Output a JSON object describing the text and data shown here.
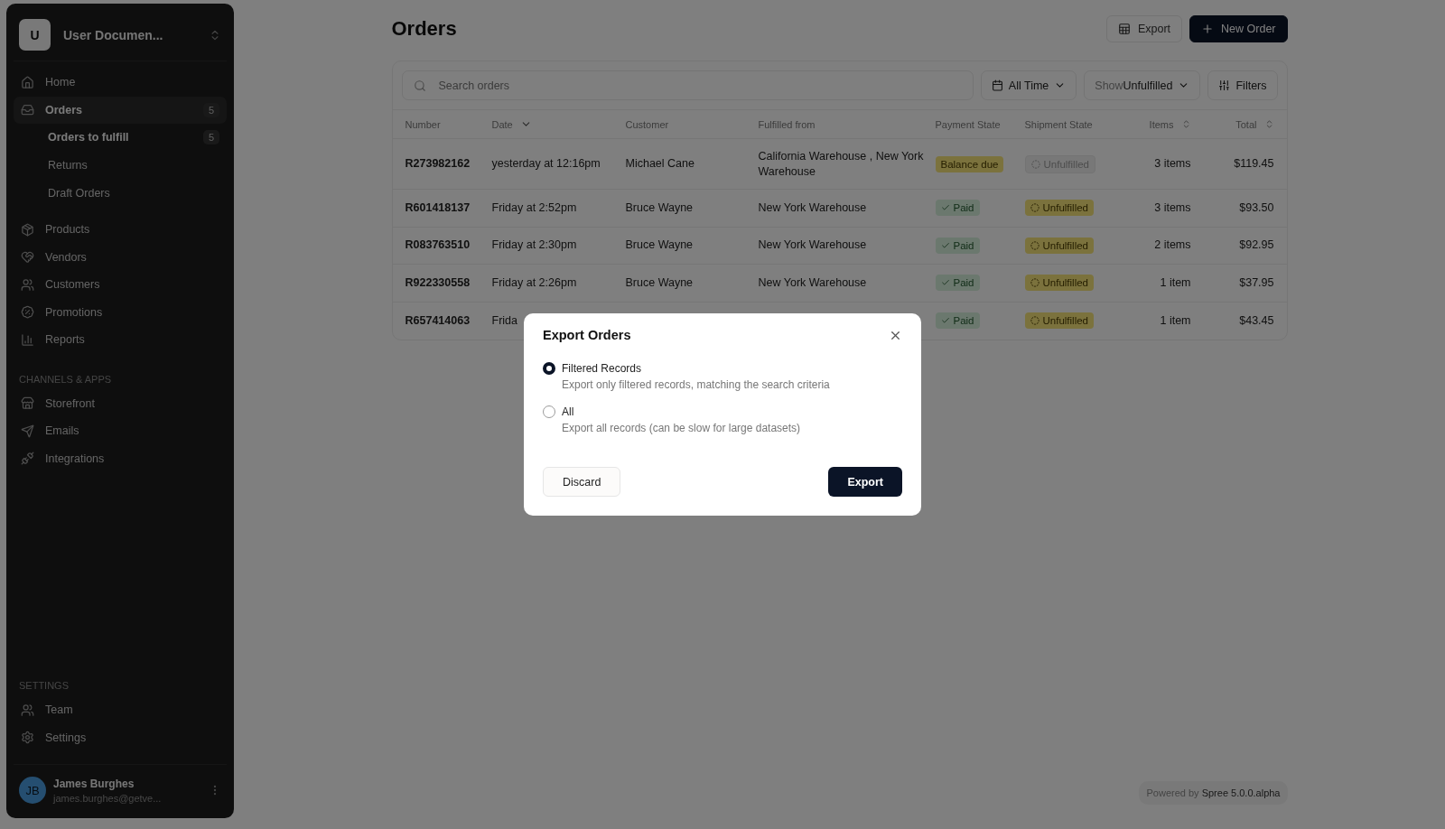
{
  "workspace": {
    "initial": "U",
    "name": "User Documen..."
  },
  "nav": [
    {
      "label": "Home",
      "selected": false
    },
    {
      "label": "Orders",
      "selected": true,
      "count": "5",
      "children": [
        {
          "label": "Orders to fulfill",
          "selected": true,
          "count": "5"
        },
        {
          "label": "Returns",
          "selected": false
        },
        {
          "label": "Draft Orders",
          "selected": false
        }
      ]
    },
    {
      "label": "Products",
      "selected": false
    },
    {
      "label": "Vendors",
      "selected": false
    },
    {
      "label": "Customers",
      "selected": false
    },
    {
      "label": "Promotions",
      "selected": false
    },
    {
      "label": "Reports",
      "selected": false
    }
  ],
  "channels": {
    "heading": "CHANNELS & APPS",
    "items": [
      {
        "label": "Storefront",
        "selected": false
      },
      {
        "label": "Emails",
        "selected": false
      },
      {
        "label": "Integrations",
        "selected": false
      }
    ]
  },
  "settings": {
    "heading": "SETTINGS",
    "items": [
      {
        "label": "Team",
        "selected": false
      },
      {
        "label": "Settings",
        "selected": false
      }
    ]
  },
  "user": {
    "initials": "JB",
    "name": "James Burghes",
    "email": "james.burghes@getve..."
  },
  "page": {
    "title": "Orders",
    "actions": [
      {
        "kind": "secondary",
        "label": "Export"
      },
      {
        "kind": "primary",
        "label": "New Order"
      }
    ]
  },
  "toolbar": {
    "search": {
      "placeholder": "Search orders"
    },
    "filters": [
      {
        "kind": "date",
        "value": "All Time"
      },
      {
        "kind": "select",
        "label": "Show",
        "value": "Unfulfilled"
      },
      {
        "kind": "filters",
        "value": "Filters"
      }
    ]
  },
  "table": {
    "columns": [
      {
        "label": "Number",
        "sorted": false,
        "sortable": false
      },
      {
        "label": "Date",
        "sorted": true,
        "sortable": true
      },
      {
        "label": "Customer",
        "sorted": false,
        "sortable": false
      },
      {
        "label": "Fulfilled from",
        "sorted": false,
        "sortable": false
      },
      {
        "label": "Payment State",
        "sorted": false,
        "sortable": false
      },
      {
        "label": "Shipment State",
        "sorted": false,
        "sortable": false
      },
      {
        "label": "Items",
        "sorted": false,
        "sortable": true
      },
      {
        "label": "Total",
        "sorted": false,
        "sortable": true
      }
    ],
    "rows": [
      {
        "number": "R273982162",
        "date": "yesterday at 12:16pm",
        "customer": "Michael Cane",
        "fulfilled_from": "California Warehouse , New York Warehouse",
        "payment": {
          "label": "Balance due",
          "kind": "warning"
        },
        "shipment": {
          "label": "Unfulfilled",
          "kind": "neutral"
        },
        "items": "3 items",
        "total": "$119.45"
      },
      {
        "number": "R601418137",
        "date": "Friday at 2:52pm",
        "customer": "Bruce Wayne",
        "fulfilled_from": "New York Warehouse",
        "payment": {
          "label": "Paid",
          "kind": "success"
        },
        "shipment": {
          "label": "Unfulfilled",
          "kind": "warning"
        },
        "items": "3 items",
        "total": "$93.50"
      },
      {
        "number": "R083763510",
        "date": "Friday at 2:30pm",
        "customer": "Bruce Wayne",
        "fulfilled_from": "New York Warehouse",
        "payment": {
          "label": "Paid",
          "kind": "success"
        },
        "shipment": {
          "label": "Unfulfilled",
          "kind": "warning"
        },
        "items": "2 items",
        "total": "$92.95"
      },
      {
        "number": "R922330558",
        "date": "Friday at 2:26pm",
        "customer": "Bruce Wayne",
        "fulfilled_from": "New York Warehouse",
        "payment": {
          "label": "Paid",
          "kind": "success"
        },
        "shipment": {
          "label": "Unfulfilled",
          "kind": "warning"
        },
        "items": "1 item",
        "total": "$37.95"
      },
      {
        "number": "R657414063",
        "date": "Frida",
        "payment": {
          "label": "Paid",
          "kind": "success"
        },
        "shipment": {
          "label": "Unfulfilled",
          "kind": "warning"
        },
        "items": "1 item",
        "total": "$43.45"
      }
    ]
  },
  "powered_by": {
    "label": "Powered by",
    "product": "Spree 5.0.0.alpha"
  },
  "dialog": {
    "title": "Export Orders",
    "options": [
      {
        "label": "Filtered Records",
        "description": "Export only filtered records, matching the search criteria",
        "selected": true
      },
      {
        "label": "All",
        "description": "Export all records (can be slow for large datasets)",
        "selected": false
      }
    ],
    "buttons": [
      {
        "kind": "secondary",
        "label": "Discard"
      },
      {
        "kind": "primary",
        "label": "Export"
      }
    ]
  }
}
